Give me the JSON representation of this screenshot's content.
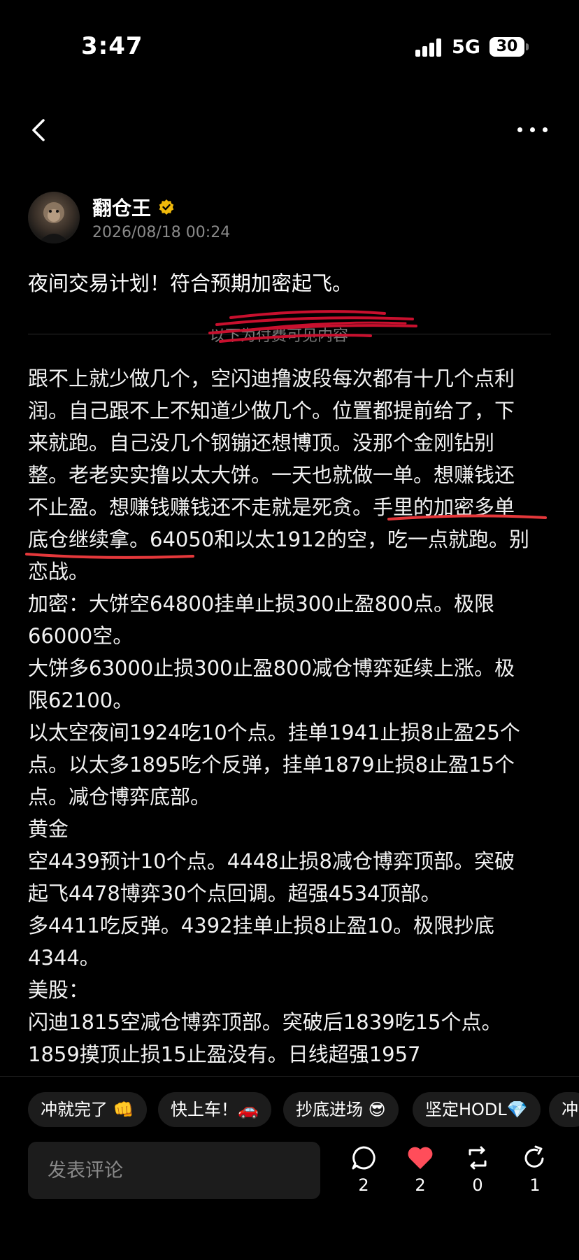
{
  "status": {
    "time": "3:47",
    "network": "5G",
    "battery": "30"
  },
  "author": {
    "name": "翻仓王",
    "date": "2026/08/18 00:24"
  },
  "post": {
    "title": "夜间交易计划！符合预期加密起飞。",
    "divider_label": "以下为付费可见内容",
    "lines": [
      "跟不上就少做几个，空闪迪撸波段每次都有十几个点利",
      "润。自己跟不上不知道少做几个。位置都提前给了，下",
      "来就跑。自己没几个钢镚还想博顶。没那个金刚钻别",
      "整。老老实实撸以太大饼。一天也就做一单。想赚钱还",
      "不止盈。想赚钱赚钱还不走就是死贪。手里的加密多单",
      "底仓继续拿。64050和以太1912的空，吃一点就跑。别",
      "恋战。",
      "加密：大饼空64800挂单止损300止盈800点。极限",
      "66000空。",
      "大饼多63000止损300止盈800减仓博弈延续上涨。极",
      "限62100。",
      "以太空夜间1924吃10个点。挂单1941止损8止盈25个",
      "点。以太多1895吃个反弹，挂单1879止损8止盈15个",
      "点。减仓博弈底部。",
      "黄金",
      "空4439预计10个点。4448止损8减仓博弈顶部。突破",
      "起飞4478博弈30个点回调。超强4534顶部。",
      "多4411吃反弹。4392挂单止损8止盈10。极限抄底",
      "4344。",
      "美股：",
      "闪迪1815空减仓博弈顶部。突破后1839吃15个点。",
      "1859摸顶止损15止盈没有。日线超强1957"
    ]
  },
  "chips": [
    "冲就完了 👊",
    "快上车！🚗",
    "抄底进场 😎",
    "坚定HODL💎",
    "冲"
  ],
  "comment": {
    "placeholder": "发表评论"
  },
  "actions": {
    "comments": "2",
    "likes": "2",
    "reposts": "0",
    "shares": "1"
  },
  "colors": {
    "accent_red": "#e5383b",
    "verified_gold": "#f0b90b",
    "like_red": "#ff4d5a"
  },
  "icons": [
    "back-arrow-icon",
    "more-icon",
    "verified-icon",
    "comment-icon",
    "heart-icon",
    "repost-icon",
    "share-icon"
  ]
}
